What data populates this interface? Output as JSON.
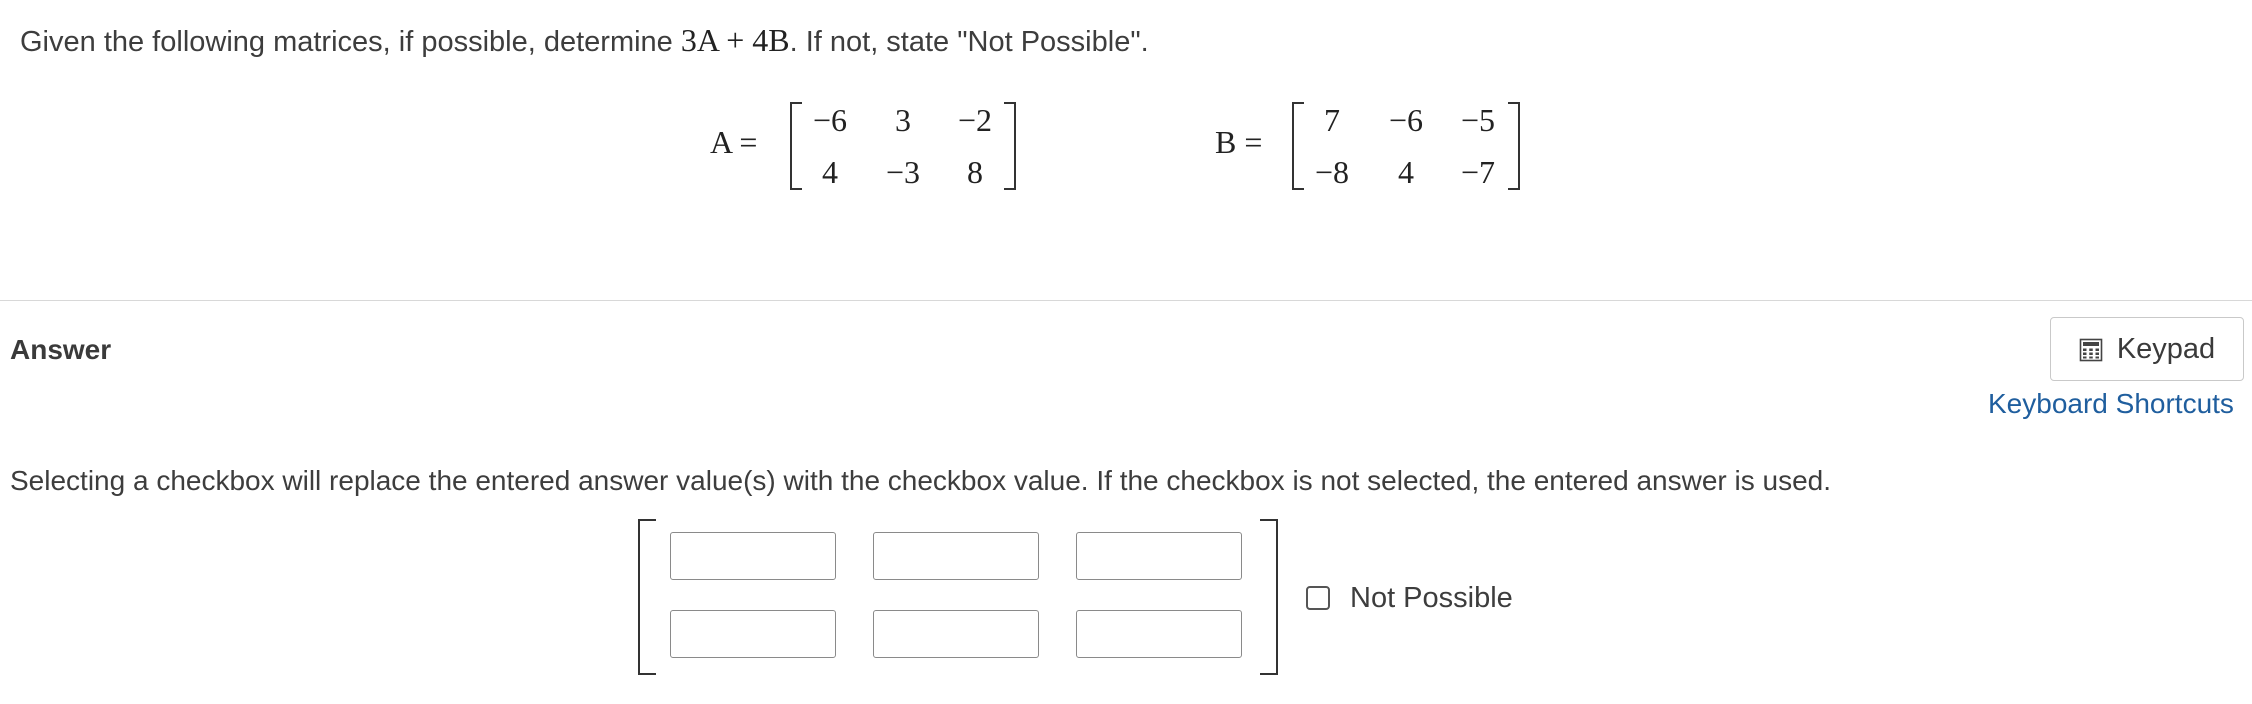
{
  "question": {
    "prefix": "Given the following matrices, if possible, determine ",
    "expression": "3A + 4B",
    "suffix": ". If not, state \"Not Possible\"."
  },
  "matrix_a": {
    "label": "A =",
    "rows": [
      [
        "−6",
        "3",
        "−2"
      ],
      [
        "4",
        "−3",
        "8"
      ]
    ]
  },
  "matrix_b": {
    "label": "B =",
    "rows": [
      [
        "7",
        "−6",
        "−5"
      ],
      [
        "−8",
        "4",
        "−7"
      ]
    ]
  },
  "answer": {
    "heading": "Answer",
    "keypad_label": "Keypad",
    "keypad_icon": "calculator-icon",
    "shortcuts_link": "Keyboard Shortcuts",
    "instructions": "Selecting a checkbox will replace the entered answer value(s) with the checkbox value. If the checkbox is not selected, the entered answer is used.",
    "cells": [
      [
        "",
        "",
        ""
      ],
      [
        "",
        "",
        ""
      ]
    ],
    "checkbox_label": "Not Possible",
    "checkbox_checked": false
  },
  "colors": {
    "link": "#1f5e9e",
    "text": "#3d3d3d",
    "divider": "#d8d8d8"
  }
}
